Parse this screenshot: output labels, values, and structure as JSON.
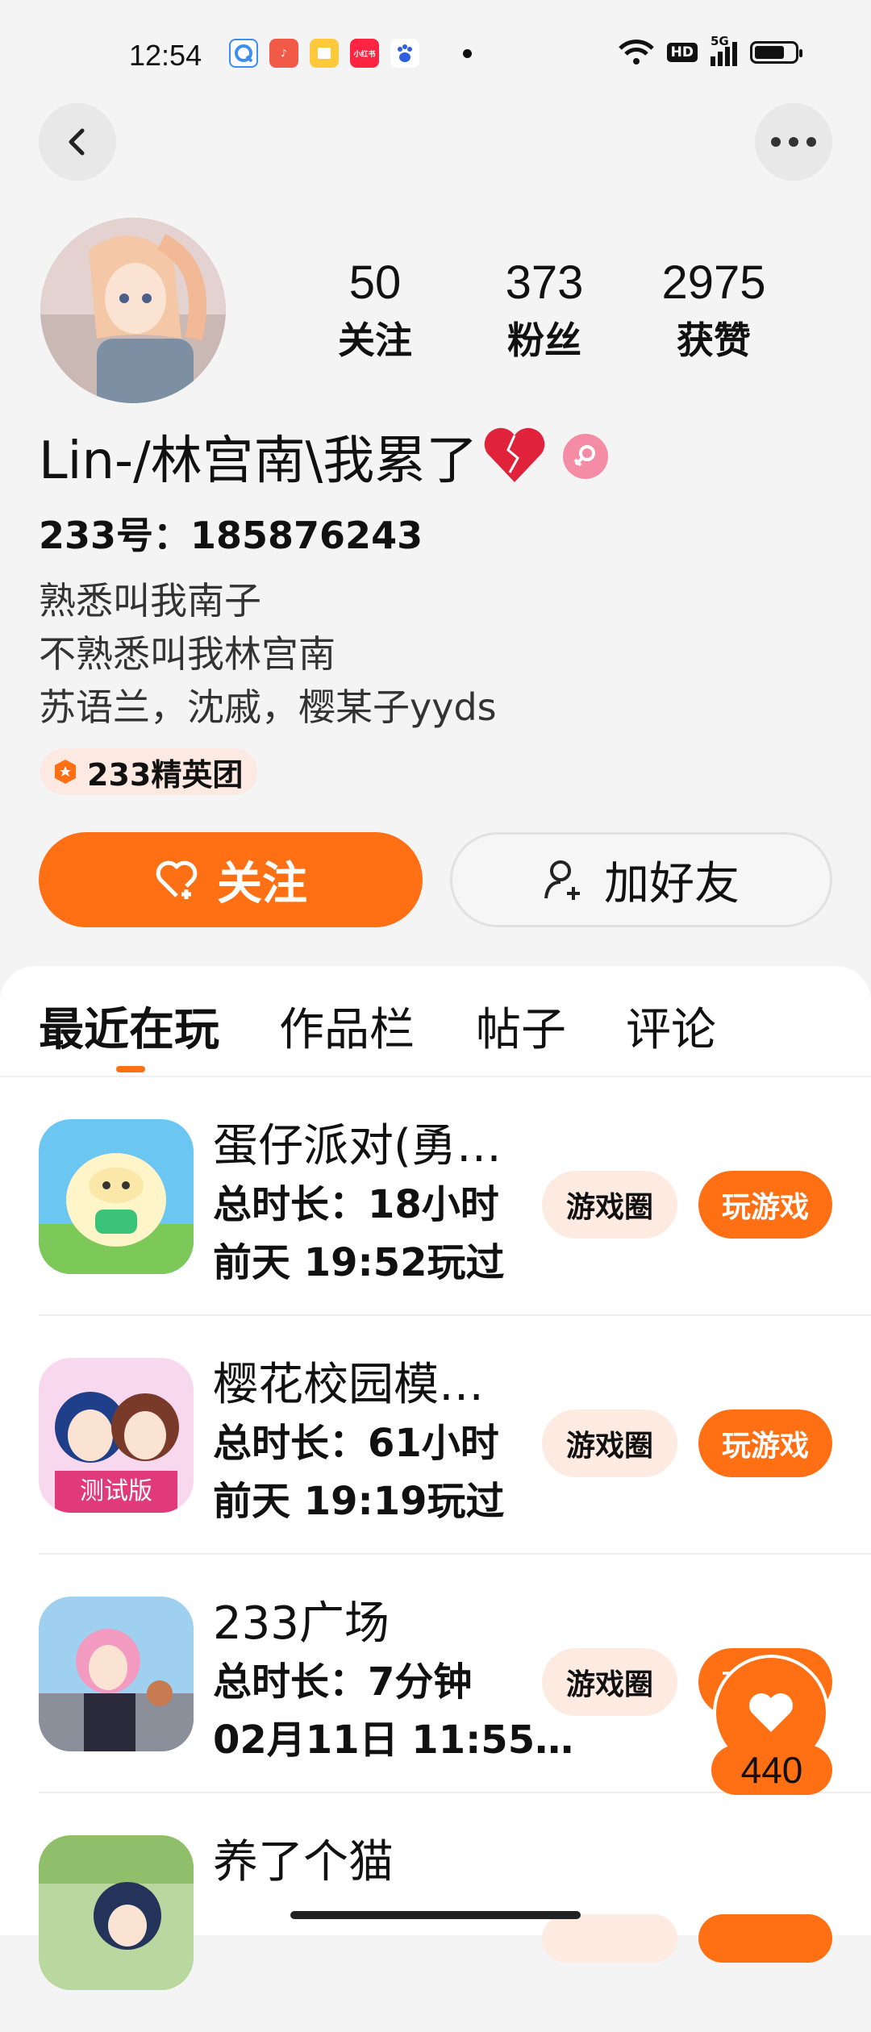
{
  "status_bar": {
    "time": "12:54",
    "icons": [
      "browser-icon",
      "music-icon",
      "notes-icon",
      "xiaohongshu-icon",
      "baidu-icon"
    ],
    "xhs_label": "小红书",
    "hd": "HD",
    "signal": "5G"
  },
  "profile": {
    "stats": [
      {
        "num": "50",
        "label": "关注"
      },
      {
        "num": "373",
        "label": "粉丝"
      },
      {
        "num": "2975",
        "label": "获赞"
      }
    ],
    "name": "Lin-/林宫南\\我累了",
    "heart": "💔",
    "uid": "233号：185876243",
    "bio": [
      "熟悉叫我南子",
      "不熟悉叫我林宫南",
      "苏语兰，沈戚，樱某子yyds"
    ],
    "badge": "233精英团"
  },
  "actions": {
    "follow": "关注",
    "add_friend": "加好友"
  },
  "tabs": [
    "最近在玩",
    "作品栏",
    "帖子",
    "评论"
  ],
  "games": [
    {
      "title": "蛋仔派对(勇…",
      "duration": "总时长：18小时",
      "last": "前天 19:52玩过",
      "circle": "游戏圈",
      "play": "玩游戏"
    },
    {
      "title": "樱花校园模…",
      "duration": "总时长：61小时",
      "last": "前天 19:19玩过",
      "circle": "游戏圈",
      "play": "玩游戏"
    },
    {
      "title": "233广场",
      "duration": "总时长：7分钟",
      "last": "02月11日 11:55…",
      "circle": "游戏圈",
      "play": "玩游戏"
    },
    {
      "title": "养了个猫",
      "duration": "",
      "last": "",
      "circle": "",
      "play": ""
    }
  ],
  "icon2_text": "测试版",
  "float_like": {
    "count": "440"
  },
  "colors": {
    "accent": "#ff6f14",
    "pill_bg": "#fdebe2",
    "gender": "#f58ca6"
  }
}
